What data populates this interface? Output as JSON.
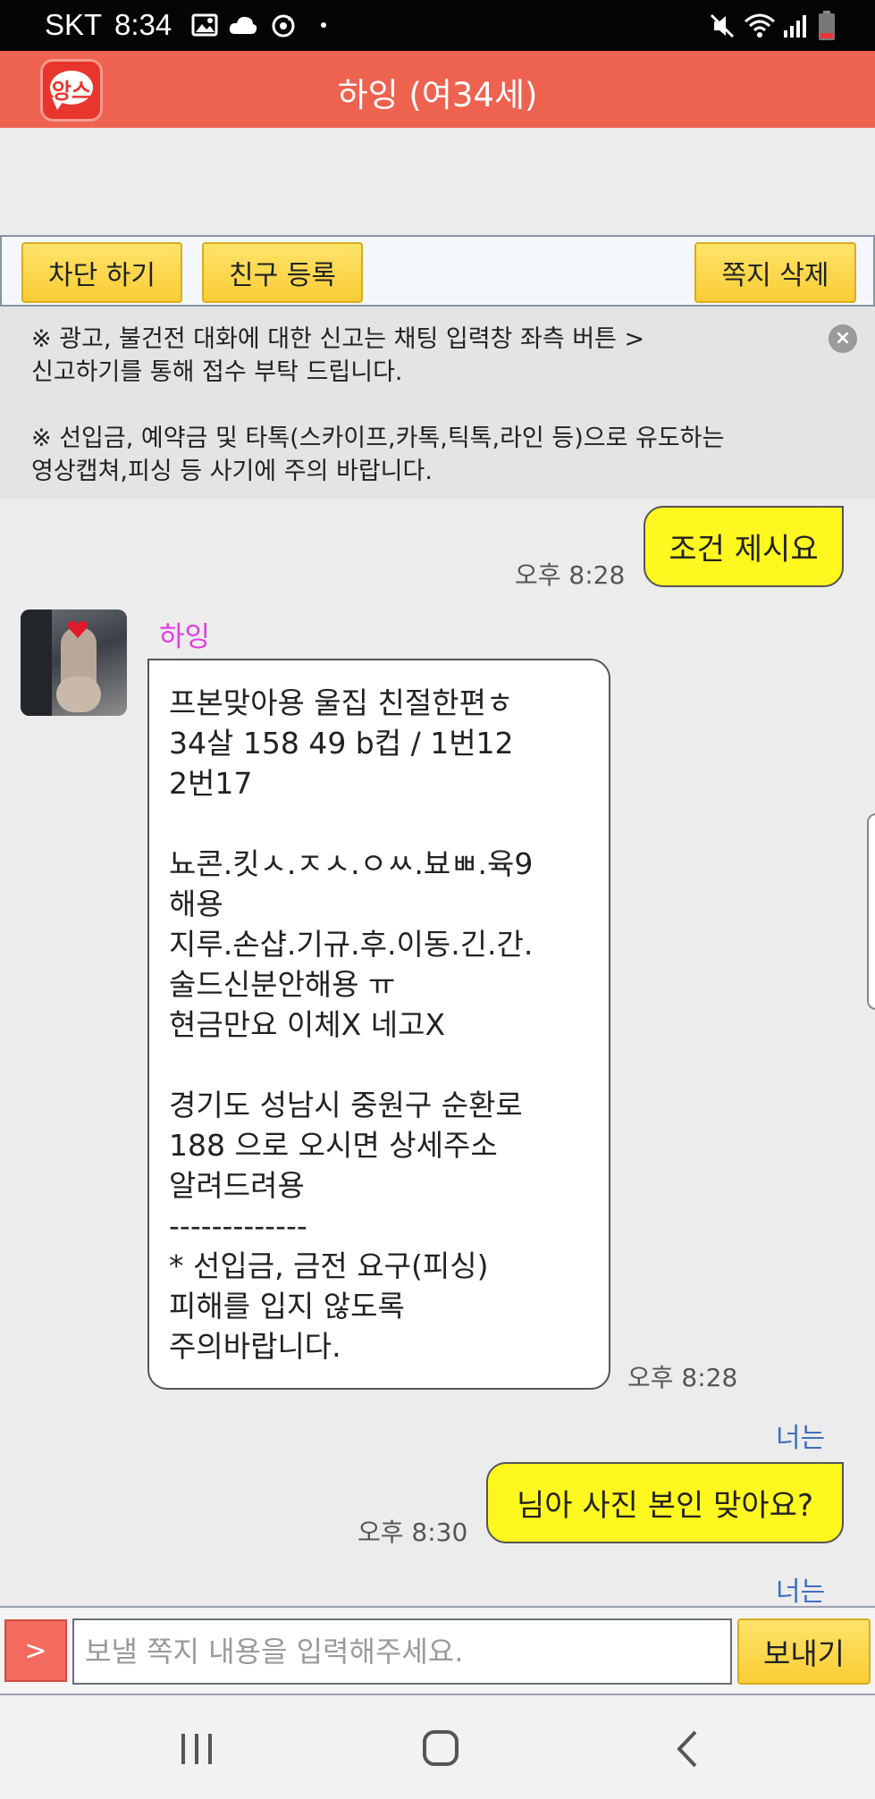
{
  "status_bar": {
    "carrier": "SKT",
    "time": "8:34",
    "left_icons": [
      "image-icon",
      "cloud-icon",
      "sync-icon",
      "dot-icon"
    ],
    "right_icons": [
      "mute-icon",
      "wifi-icon",
      "signal-icon",
      "battery-icon"
    ]
  },
  "header": {
    "logo_text": "앙스",
    "title": "하잉 (여34세)"
  },
  "action_bar": {
    "block_label": "차단 하기",
    "add_friend_label": "친구 등록",
    "delete_label": "쪽지 삭제"
  },
  "notice": {
    "line1a": "※ 광고, 불건전 대화에 대한 신고는 채팅 입력창 좌측 버튼 >",
    "line1b": "신고하기를 통해 접수 부탁 드립니다.",
    "line2a": "※ 선입금, 예약금 및 타톡(스카이프,카톡,틱톡,라인 등)으로 유도하는",
    "line2b": "영상캡쳐,피싱 등 사기에 주의 바랍니다.",
    "close_icon": "close-icon"
  },
  "messages": {
    "m1": {
      "text": "조건 제시요",
      "time": "오후 8:28"
    },
    "m2": {
      "sender": "하잉",
      "time": "오후 8:28",
      "lines": [
        "프본맞아용 울집 친절한편ㅎ",
        "34살 158 49 b컵 / 1번12",
        "2번17",
        "",
        "뇨콘.킷ㅅ.ㅈㅅ.ㅇㅆ.뵤ㅃ.육9",
        "해용",
        "지루.손샵.기규.후.이동.긴.간.",
        "술드신분안해용 ㅠ",
        "현금만요 이체X 네고X",
        "",
        "경기도 성남시 중원구 순환로",
        "188 으로 오시면 상세주소",
        "알려드려용",
        "-------------",
        "* 선입금, 금전 요구(피싱)",
        "피해를 입지 않도록",
        "주의바랍니다."
      ]
    },
    "m3": {
      "label": "너는",
      "text": "님아 사진 본인 맞아요?",
      "time": "오후 8:30"
    },
    "m4": {
      "label": "너는"
    }
  },
  "input_bar": {
    "menu_label": ">",
    "placeholder": "보낼 쪽지 내용을 입력해주세요.",
    "value": "",
    "send_label": "보내기"
  },
  "nav_bar": {
    "icons": [
      "recent-apps-icon",
      "home-icon",
      "back-icon"
    ]
  },
  "colors": {
    "header": "#ee6250",
    "my_bubble": "#fff720",
    "button_yellow": "#f9cd35",
    "sender_name": "#e33ce0",
    "you_label": "#3d6fbf"
  }
}
